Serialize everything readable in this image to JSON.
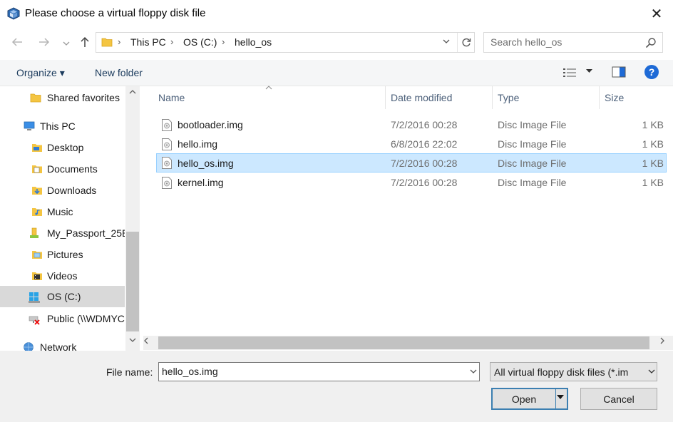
{
  "window": {
    "title": "Please choose a virtual floppy disk file",
    "close_glyph": "✕"
  },
  "address": {
    "breadcrumbs": [
      "This PC",
      "OS (C:)",
      "hello_os"
    ],
    "separator": "›"
  },
  "search": {
    "placeholder": "Search hello_os"
  },
  "toolbar": {
    "organize_label": "Organize ▾",
    "new_folder_label": "New folder",
    "help_glyph": "?"
  },
  "nav": {
    "items": [
      {
        "label": "Shared favorites",
        "icon": "folder-icon"
      },
      {
        "label": "This PC",
        "icon": "computer-icon"
      },
      {
        "label": "Desktop",
        "icon": "desktop-folder-icon"
      },
      {
        "label": "Documents",
        "icon": "documents-folder-icon"
      },
      {
        "label": "Downloads",
        "icon": "downloads-folder-icon"
      },
      {
        "label": "Music",
        "icon": "music-folder-icon"
      },
      {
        "label": "My_Passport_25E",
        "icon": "usb-drive-icon"
      },
      {
        "label": "Pictures",
        "icon": "pictures-folder-icon"
      },
      {
        "label": "Videos",
        "icon": "videos-folder-icon"
      },
      {
        "label": "OS (C:)",
        "icon": "windows-drive-icon"
      },
      {
        "label": "Public (\\\\WDMYC",
        "icon": "disconnected-network-drive-icon"
      },
      {
        "label": "Network",
        "icon": "network-icon"
      }
    ],
    "selected": "OS (C:)"
  },
  "files": {
    "columns": [
      "Name",
      "Date modified",
      "Type",
      "Size"
    ],
    "rows": [
      {
        "name": "bootloader.img",
        "date": "7/2/2016 00:28",
        "type": "Disc Image File",
        "size": "1 KB"
      },
      {
        "name": "hello.img",
        "date": "6/8/2016 22:02",
        "type": "Disc Image File",
        "size": "1 KB"
      },
      {
        "name": "hello_os.img",
        "date": "7/2/2016 00:28",
        "type": "Disc Image File",
        "size": "1 KB"
      },
      {
        "name": "kernel.img",
        "date": "7/2/2016 00:28",
        "type": "Disc Image File",
        "size": "1 KB"
      }
    ],
    "selected": "hello_os.img"
  },
  "bottom": {
    "filename_label": "File name:",
    "filename_value": "hello_os.img",
    "filter_value": "All virtual floppy disk files (*.im",
    "open_label": "Open",
    "cancel_label": "Cancel"
  },
  "colors": {
    "selection_bg": "#cce8ff",
    "selection_border": "#99d1ff",
    "help_blue": "#1e6ad6",
    "folder_yellow": "#f4c542",
    "open_border": "#3c7fb1"
  }
}
